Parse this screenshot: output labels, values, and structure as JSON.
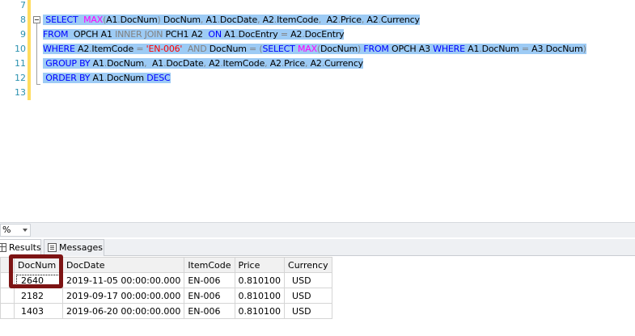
{
  "editor": {
    "line_numbers": [
      "7",
      "8",
      "9",
      "10",
      "11",
      "12",
      "13"
    ],
    "lines": [
      {
        "segments": []
      },
      {
        "segments": [
          {
            "t": " ",
            "c": ""
          },
          {
            "t": "SELECT",
            "c": "kw"
          },
          {
            "t": "  ",
            "c": ""
          },
          {
            "t": "MAX",
            "c": "fn"
          },
          {
            "t": "(",
            "c": "gray"
          },
          {
            "t": "A1",
            "c": ""
          },
          {
            "t": ".",
            "c": "gray"
          },
          {
            "t": "DocNum",
            "c": ""
          },
          {
            "t": ")",
            "c": "gray"
          },
          {
            "t": " DocNum",
            "c": ""
          },
          {
            "t": ",",
            "c": "gray"
          },
          {
            "t": " A1",
            "c": ""
          },
          {
            "t": ".",
            "c": "gray"
          },
          {
            "t": "DocDate",
            "c": ""
          },
          {
            "t": ",",
            "c": "gray"
          },
          {
            "t": " A2",
            "c": ""
          },
          {
            "t": ".",
            "c": "gray"
          },
          {
            "t": "ItemCode",
            "c": ""
          },
          {
            "t": ",",
            "c": "gray"
          },
          {
            "t": "  A2",
            "c": ""
          },
          {
            "t": ".",
            "c": "gray"
          },
          {
            "t": "Price",
            "c": ""
          },
          {
            "t": ",",
            "c": "gray"
          },
          {
            "t": " A2",
            "c": ""
          },
          {
            "t": ".",
            "c": "gray"
          },
          {
            "t": "Currency",
            "c": ""
          }
        ]
      },
      {
        "segments": [
          {
            "t": "FROM",
            "c": "kw"
          },
          {
            "t": "  OPCH A1 ",
            "c": ""
          },
          {
            "t": "INNER JOIN",
            "c": "gray"
          },
          {
            "t": " PCH1 A2  ",
            "c": ""
          },
          {
            "t": "ON",
            "c": "kw"
          },
          {
            "t": " A1",
            "c": ""
          },
          {
            "t": ".",
            "c": "gray"
          },
          {
            "t": "DocEntry ",
            "c": ""
          },
          {
            "t": "=",
            "c": "gray"
          },
          {
            "t": " A2",
            "c": ""
          },
          {
            "t": ".",
            "c": "gray"
          },
          {
            "t": "DocEntry",
            "c": ""
          }
        ]
      },
      {
        "segments": [
          {
            "t": "WHERE",
            "c": "kw"
          },
          {
            "t": " A2",
            "c": ""
          },
          {
            "t": ".",
            "c": "gray"
          },
          {
            "t": "ItemCode ",
            "c": ""
          },
          {
            "t": "=",
            "c": "gray"
          },
          {
            "t": " ",
            "c": ""
          },
          {
            "t": "'EN-006'",
            "c": "str"
          },
          {
            "t": "  ",
            "c": ""
          },
          {
            "t": "AND",
            "c": "gray"
          },
          {
            "t": " DocNum ",
            "c": ""
          },
          {
            "t": "=",
            "c": "gray"
          },
          {
            "t": " ",
            "c": ""
          },
          {
            "t": "(",
            "c": "gray"
          },
          {
            "t": "SELECT",
            "c": "kw"
          },
          {
            "t": " ",
            "c": ""
          },
          {
            "t": "MAX",
            "c": "fn"
          },
          {
            "t": "(",
            "c": "gray"
          },
          {
            "t": "DocNum",
            "c": ""
          },
          {
            "t": ")",
            "c": "gray"
          },
          {
            "t": " ",
            "c": ""
          },
          {
            "t": "FROM",
            "c": "kw"
          },
          {
            "t": " OPCH A3 ",
            "c": ""
          },
          {
            "t": "WHERE",
            "c": "kw"
          },
          {
            "t": " A1",
            "c": ""
          },
          {
            "t": ".",
            "c": "gray"
          },
          {
            "t": "DocNum ",
            "c": ""
          },
          {
            "t": "=",
            "c": "gray"
          },
          {
            "t": " A3",
            "c": ""
          },
          {
            "t": ".",
            "c": "gray"
          },
          {
            "t": "DocNum",
            "c": ""
          },
          {
            "t": ")",
            "c": "gray"
          }
        ]
      },
      {
        "segments": [
          {
            "t": " ",
            "c": ""
          },
          {
            "t": "GROUP BY",
            "c": "kw"
          },
          {
            "t": " A1",
            "c": ""
          },
          {
            "t": ".",
            "c": "gray"
          },
          {
            "t": "DocNum",
            "c": ""
          },
          {
            "t": ",",
            "c": "gray"
          },
          {
            "t": "  A1",
            "c": ""
          },
          {
            "t": ".",
            "c": "gray"
          },
          {
            "t": "DocDate",
            "c": ""
          },
          {
            "t": ",",
            "c": "gray"
          },
          {
            "t": " A2",
            "c": ""
          },
          {
            "t": ".",
            "c": "gray"
          },
          {
            "t": "ItemCode",
            "c": ""
          },
          {
            "t": ",",
            "c": "gray"
          },
          {
            "t": " A2",
            "c": ""
          },
          {
            "t": ".",
            "c": "gray"
          },
          {
            "t": "Price",
            "c": ""
          },
          {
            "t": ",",
            "c": "gray"
          },
          {
            "t": " A2",
            "c": ""
          },
          {
            "t": ".",
            "c": "gray"
          },
          {
            "t": "Currency",
            "c": ""
          }
        ]
      },
      {
        "segments": [
          {
            "t": " ",
            "c": ""
          },
          {
            "t": "ORDER BY",
            "c": "kw"
          },
          {
            "t": " A1",
            "c": ""
          },
          {
            "t": ".",
            "c": "gray"
          },
          {
            "t": "DocNum ",
            "c": ""
          },
          {
            "t": "DESC",
            "c": "kw"
          }
        ]
      },
      {
        "segments": []
      }
    ]
  },
  "zoom": {
    "value": "%"
  },
  "tabs": {
    "results": "Results",
    "messages": "Messages"
  },
  "grid": {
    "columns": [
      "DocNum",
      "DocDate",
      "ItemCode",
      "Price",
      "Currency"
    ],
    "rows": [
      [
        "2640",
        "2019-11-05 00:00:00.000",
        "EN-006",
        "0.810100",
        "USD"
      ],
      [
        "2182",
        "2019-09-17 00:00:00.000",
        "EN-006",
        "0.810100",
        "USD"
      ],
      [
        "1403",
        "2019-06-20 00:00:00.000",
        "EN-006",
        "0.810100",
        "USD"
      ]
    ]
  }
}
